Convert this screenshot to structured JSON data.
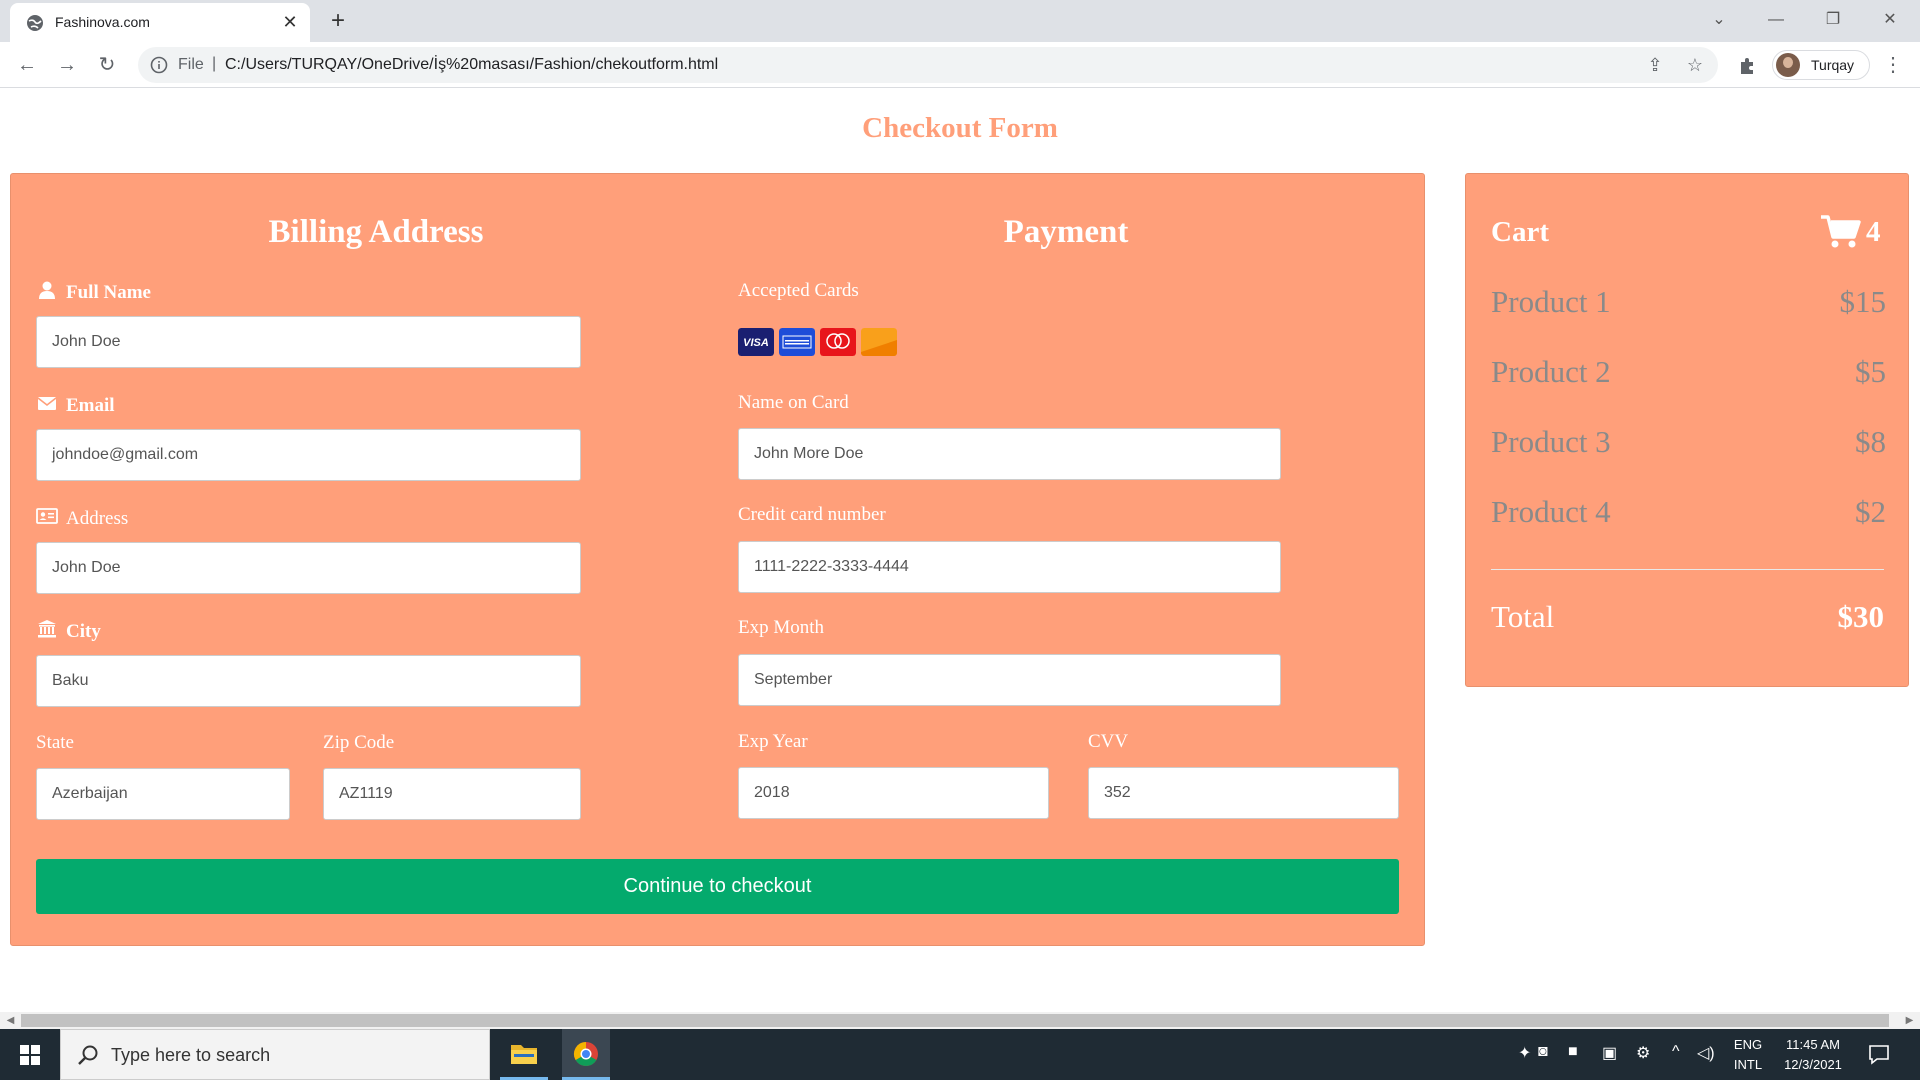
{
  "browser": {
    "tab_title": "Fashinova.com",
    "new_tab_label": "+",
    "address_scheme": "File",
    "address_url": "C:/Users/TURQAY/OneDrive/İş%20masası/Fashion/chekoutform.html",
    "profile_name": "Turqay",
    "icons": [
      "globe-icon",
      "close-icon",
      "back-icon",
      "forward-icon",
      "reload-icon",
      "info-icon",
      "share-icon",
      "star-icon",
      "extensions-icon",
      "menu-icon"
    ]
  },
  "page": {
    "title": "Checkout Form",
    "billing": {
      "heading": "Billing Address",
      "full_name_label": "Full Name",
      "full_name_value": "John Doe",
      "email_label": "Email",
      "email_value": "johndoe@gmail.com",
      "address_label": "Address",
      "address_value": "John Doe",
      "city_label": "City",
      "city_value": "Baku",
      "state_label": "State",
      "state_value": "Azerbaijan",
      "zip_label": "Zip Code",
      "zip_value": "AZ1119"
    },
    "payment": {
      "heading": "Payment",
      "accepted_cards_label": "Accepted Cards",
      "cards": [
        "visa",
        "amex",
        "mastercard",
        "discover"
      ],
      "name_on_card_label": "Name on Card",
      "name_on_card_value": "John More Doe",
      "card_number_label": "Credit card number",
      "card_number_value": "1111-2222-3333-4444",
      "exp_month_label": "Exp Month",
      "exp_month_value": "September",
      "exp_year_label": "Exp Year",
      "exp_year_value": "2018",
      "cvv_label": "CVV",
      "cvv_value": "352"
    },
    "submit_label": "Continue to checkout",
    "cart": {
      "title": "Cart",
      "count": "4",
      "items": [
        {
          "name": "Product 1",
          "price": "$15"
        },
        {
          "name": "Product 2",
          "price": "$5"
        },
        {
          "name": "Product 3",
          "price": "$8"
        },
        {
          "name": "Product 4",
          "price": "$2"
        }
      ],
      "total_label": "Total",
      "total_value": "$30"
    }
  },
  "colors": {
    "panel": "#ff9f7a",
    "title": "#ff9f7a",
    "submit": "#04aa6d",
    "cart_text": "#8a8a8a"
  },
  "taskbar": {
    "search_placeholder": "Type here to search",
    "lang_top": "ENG",
    "lang_bottom": "INTL",
    "time": "11:45 AM",
    "date": "12/3/2021"
  }
}
